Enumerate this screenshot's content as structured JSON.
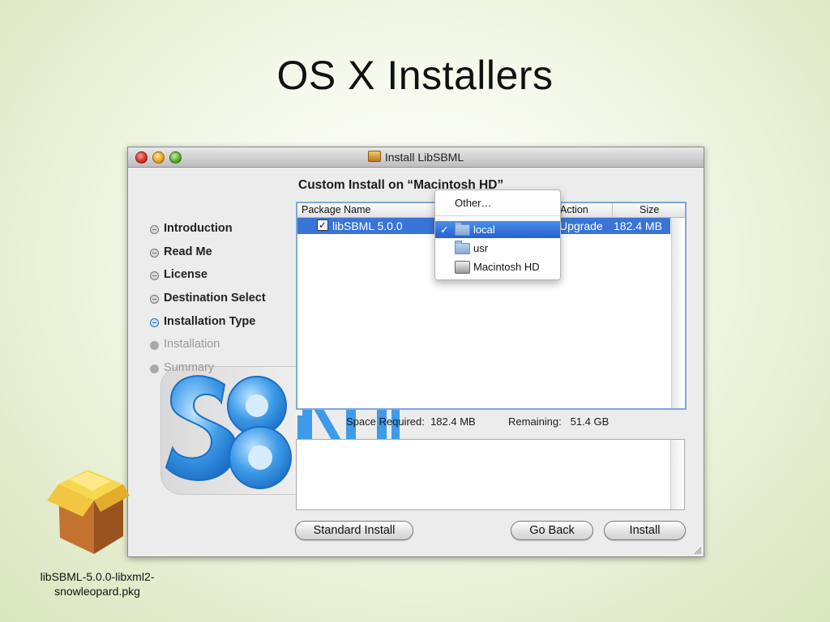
{
  "slide": {
    "title": "OS X Installers"
  },
  "window": {
    "title": "Install LibSBML"
  },
  "sidebar": {
    "steps": [
      {
        "label": "Introduction",
        "state": "done"
      },
      {
        "label": "Read Me",
        "state": "done"
      },
      {
        "label": "License",
        "state": "done"
      },
      {
        "label": "Destination Select",
        "state": "done"
      },
      {
        "label": "Installation Type",
        "state": "active"
      },
      {
        "label": "Installation",
        "state": "future"
      },
      {
        "label": "Summary",
        "state": "future"
      }
    ]
  },
  "main": {
    "heading": "Custom Install on “Macintosh HD”",
    "table": {
      "headers": {
        "package": "Package Name",
        "action": "Action",
        "size": "Size"
      },
      "rows": [
        {
          "name": "libSBML 5.0.0",
          "checked": true,
          "action": "Upgrade",
          "size": "182.4 MB"
        }
      ]
    },
    "location_menu": {
      "other": "Other…",
      "items": [
        {
          "label": "local",
          "icon": "folder-icon",
          "selected": true
        },
        {
          "label": "usr",
          "icon": "folder-icon",
          "selected": false
        },
        {
          "label": "Macintosh HD",
          "icon": "hard-disk-icon",
          "selected": false
        }
      ]
    },
    "space": {
      "required_label": "Space Required:",
      "required_value": "182.4 MB",
      "remaining_label": "Remaining:",
      "remaining_value": "51.4 GB"
    }
  },
  "buttons": {
    "standard_install": "Standard Install",
    "go_back": "Go Back",
    "install": "Install"
  },
  "package_file": {
    "line1": "libSBML-5.0.0-libxml2-",
    "line2": "snowleopard.pkg"
  },
  "colors": {
    "selection": "#3875d7",
    "menu_selection": "#2f6edb",
    "logo_blue": "#3e9be8"
  }
}
